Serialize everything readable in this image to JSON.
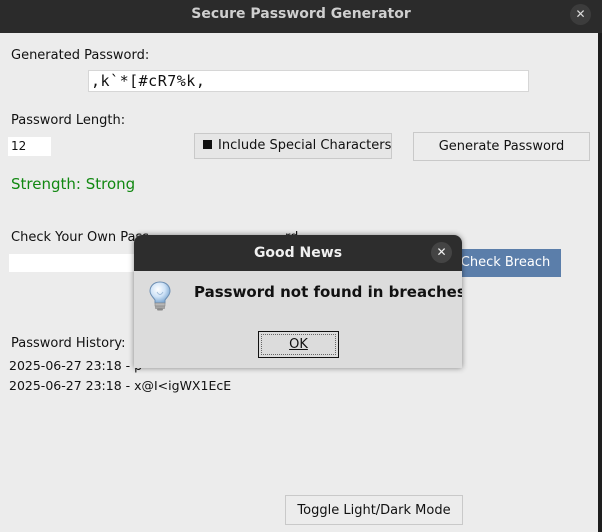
{
  "window": {
    "title": "Secure Password Generator",
    "close_glyph": "✕"
  },
  "generator": {
    "password_label": "Generated Password:",
    "password_value": ",k`*[#cR7%k,",
    "length_label": "Password Length:",
    "length_value": "12",
    "special_chars_label": "Include Special Characters",
    "special_chars_checked": true,
    "generate_button": "Generate Password",
    "strength_text": "Strength: Strong",
    "strength_color": "#118811"
  },
  "check": {
    "label_visible": "Check Your Own Pass",
    "label_tail_visible": "rd",
    "input_value": "",
    "breach_button": "Check Breach",
    "breach_button_color": "#5b7eaa"
  },
  "history": {
    "label": "Password History:",
    "items": [
      "2025-06-27 23:18 - p",
      "2025-06-27 23:18 - x@I<igWX1EcE"
    ]
  },
  "footer": {
    "toggle_button": "Toggle Light/Dark Mode"
  },
  "dialog": {
    "title": "Good News",
    "message": "Password not found in breaches.",
    "ok_button": "OK",
    "icon": "lightbulb-icon",
    "close_glyph": "✕"
  }
}
